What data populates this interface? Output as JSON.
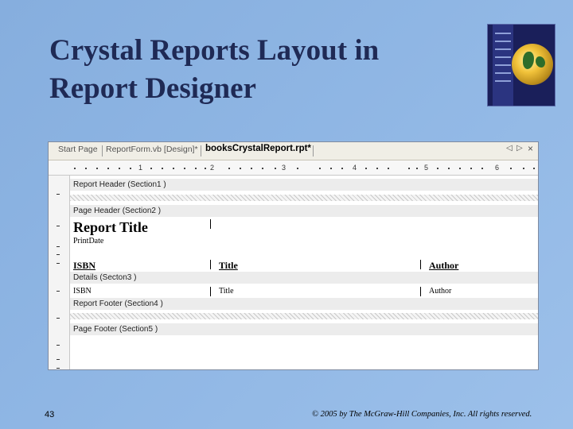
{
  "slide": {
    "title_line1": "Crystal Reports Layout in",
    "title_line2": "Report Designer",
    "page_number": "43",
    "copyright": "© 2005 by The McGraw-Hill Companies, Inc. All rights reserved."
  },
  "designer": {
    "tabs": [
      {
        "label": "Start Page"
      },
      {
        "label": "ReportForm.vb [Design]*"
      },
      {
        "label": "booksCrystalReport.rpt*",
        "active": true
      }
    ],
    "tab_nav": {
      "prev": "◁",
      "next": "▷",
      "close": "×"
    },
    "ruler_numbers": [
      "1",
      "2",
      "3",
      "4",
      "5",
      "6"
    ],
    "sections": {
      "report_header": "Report Header (Section1 )",
      "page_header": "Page Header (Section2 )",
      "details": "Details (Secton3 )",
      "report_footer": "Report Footer (Section4 )",
      "page_footer": "Page Footer (Section5 )"
    },
    "fields": {
      "report_title": "Report Title",
      "print_date": "PrintDate",
      "col_isbn": "ISBN",
      "col_title": "Title",
      "col_author": "Author",
      "detail_isbn": "ISBN",
      "detail_title": "Title",
      "detail_author": "Author"
    }
  }
}
